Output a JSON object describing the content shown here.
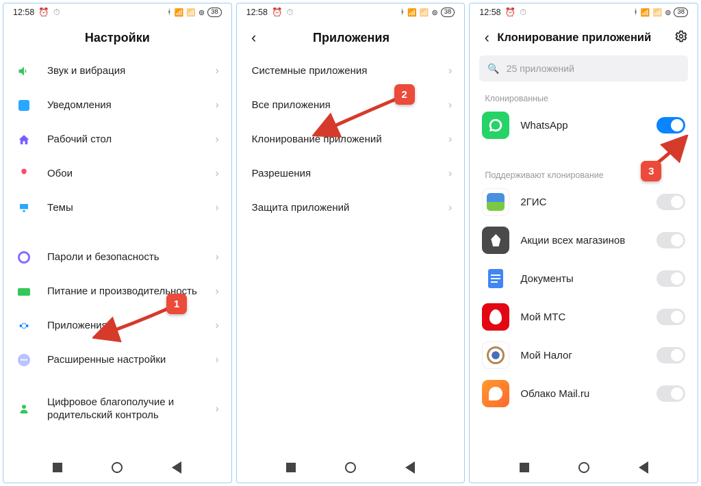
{
  "status": {
    "time": "12:58",
    "battery": "38"
  },
  "callouts": {
    "c1": "1",
    "c2": "2",
    "c3": "3"
  },
  "screen1": {
    "title": "Настройки",
    "items": [
      {
        "label": "Звук и вибрация"
      },
      {
        "label": "Уведомления"
      },
      {
        "label": "Рабочий стол"
      },
      {
        "label": "Обои"
      },
      {
        "label": "Темы"
      }
    ],
    "items2": [
      {
        "label": "Пароли и безопасность"
      },
      {
        "label": "Питание и производительность"
      },
      {
        "label": "Приложения"
      },
      {
        "label": "Расширенные настройки"
      }
    ],
    "items3": [
      {
        "label": "Цифровое благополучие и родительский контроль"
      }
    ]
  },
  "screen2": {
    "title": "Приложения",
    "items": [
      {
        "label": "Системные приложения"
      },
      {
        "label": "Все приложения"
      },
      {
        "label": "Клонирование приложений"
      },
      {
        "label": "Разрешения"
      },
      {
        "label": "Защита приложений"
      }
    ]
  },
  "screen3": {
    "title": "Клонирование приложений",
    "search_placeholder": "25 приложений",
    "section_cloned": "Клонированные",
    "section_support": "Поддерживают клонирование",
    "cloned": [
      {
        "label": "WhatsApp",
        "on": true
      }
    ],
    "supported": [
      {
        "label": "2ГИС"
      },
      {
        "label": "Акции всех магазинов"
      },
      {
        "label": "Документы"
      },
      {
        "label": "Мой МТС"
      },
      {
        "label": "Мой Налог"
      },
      {
        "label": "Облако Mail.ru"
      }
    ]
  }
}
